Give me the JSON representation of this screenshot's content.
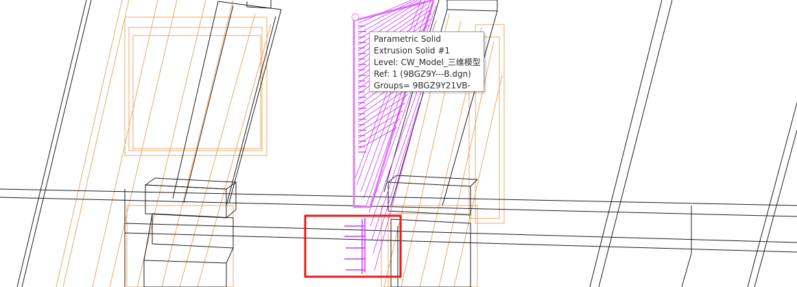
{
  "viewport": {
    "background": "#ffffff"
  },
  "colors": {
    "edge": "#1a1a1a",
    "reference_edge": "#e8a86a",
    "selection": "#cc33ff",
    "selection_light": "#e07ff0",
    "highlight_box": "#e8191c"
  },
  "tooltip": {
    "line1": "Parametric Solid",
    "line2": "Extrusion Solid #1",
    "line3": "Level: CW_Model_三维模型",
    "line4": "Ref: 1 (9BGZ9Y---B.dgn)",
    "line5": "Groups= 9BGZ9Y21VB-"
  }
}
